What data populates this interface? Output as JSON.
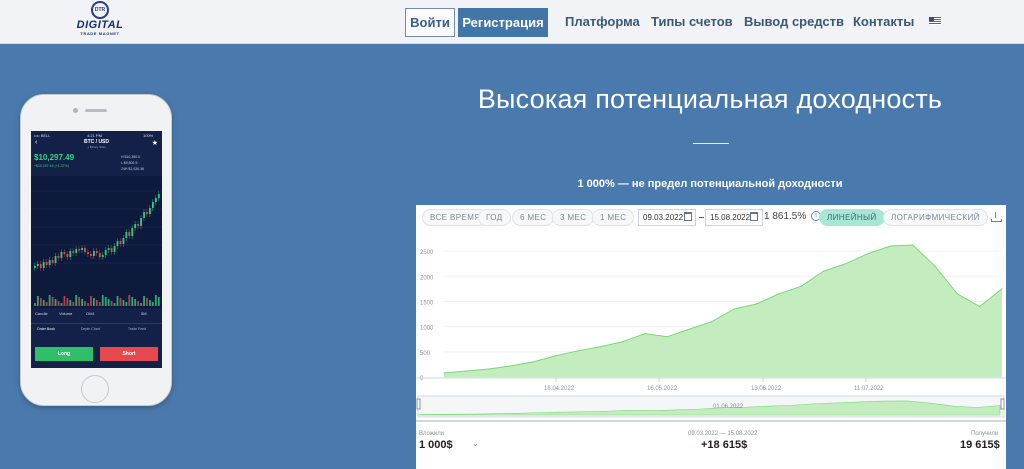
{
  "header": {
    "logo_badge": "DTR",
    "logo_main": "DIGITAL",
    "logo_sub": "TRADE MAGNET",
    "login_label": "Войти",
    "register_label": "Регистрация",
    "nav": [
      "Платформа",
      "Типы счетов",
      "Вывод средств",
      "Контакты"
    ],
    "flag_icon": "us-flag-icon"
  },
  "phone": {
    "carrier": "•••• BELL",
    "time": "4:21 PM",
    "battery": "100%",
    "pair": "BTC / USD",
    "pair_sub": "+ Binary Slots",
    "price": "$10,297.49",
    "price_change": "+$10,297.44 (+1.37%)",
    "stats": [
      "H  $10,380.0",
      "L  $9,802.5",
      "24H $1,026.36"
    ],
    "tabs": [
      "Candle",
      "Volume",
      "Ohl4",
      "5M"
    ],
    "subtabs": [
      "Order Book",
      "Depth Chart",
      "Trade Feed"
    ],
    "long_label": "Long",
    "short_label": "Short"
  },
  "hero": {
    "title": "Высокая потенциальная доходность",
    "subtitle": "1 000% — не предел потенциальной доходности"
  },
  "chart_card": {
    "ranges": [
      "ВСЕ ВРЕМЯ",
      "ГОД",
      "6 МЕС",
      "3 МЕС",
      "1 МЕС"
    ],
    "date_from": "09.03.2022",
    "date_to": "15.08.2022",
    "percent": "1 861.5%",
    "mode_linear": "ЛИНЕЙНЫЙ",
    "mode_log": "ЛОГАРИФМИЧЕСКИЙ",
    "navigator_label": "01.06.2022",
    "footer": {
      "left_label": "Вложили",
      "left_value": "1 000$",
      "mid_label": "09.03.2022 — 15.08.2022",
      "mid_value": "+18 615$",
      "right_label": "Получили",
      "right_value": "19 615$"
    },
    "colors": {
      "area_fill": "#c4edbf",
      "area_line": "#7cd67a",
      "active_mode": "#a8e6d6"
    }
  },
  "chart_data": {
    "type": "area",
    "x": [
      "09.03",
      "15.03",
      "22.03",
      "01.04",
      "10.04",
      "18.04",
      "25.04",
      "01.05",
      "08.05",
      "16.05",
      "22.05",
      "01.06",
      "08.06",
      "13.06",
      "20.06",
      "25.06",
      "01.07",
      "06.07",
      "11.07",
      "18.07",
      "25.07",
      "01.08",
      "04.08",
      "08.08",
      "11.08",
      "15.08"
    ],
    "values": [
      80,
      120,
      160,
      220,
      300,
      420,
      520,
      600,
      700,
      860,
      800,
      950,
      1100,
      1350,
      1450,
      1650,
      1800,
      2100,
      2250,
      2450,
      2600,
      2620,
      2200,
      1650,
      1400,
      1750
    ],
    "xticks": [
      "18.04.2022",
      "16.05.2022",
      "13.06.2022",
      "11.07.2022"
    ],
    "yticks": [
      "2500",
      "2000",
      "1500",
      "1000",
      "500",
      "0"
    ],
    "ylim": [
      0,
      2700
    ],
    "grid": true
  }
}
